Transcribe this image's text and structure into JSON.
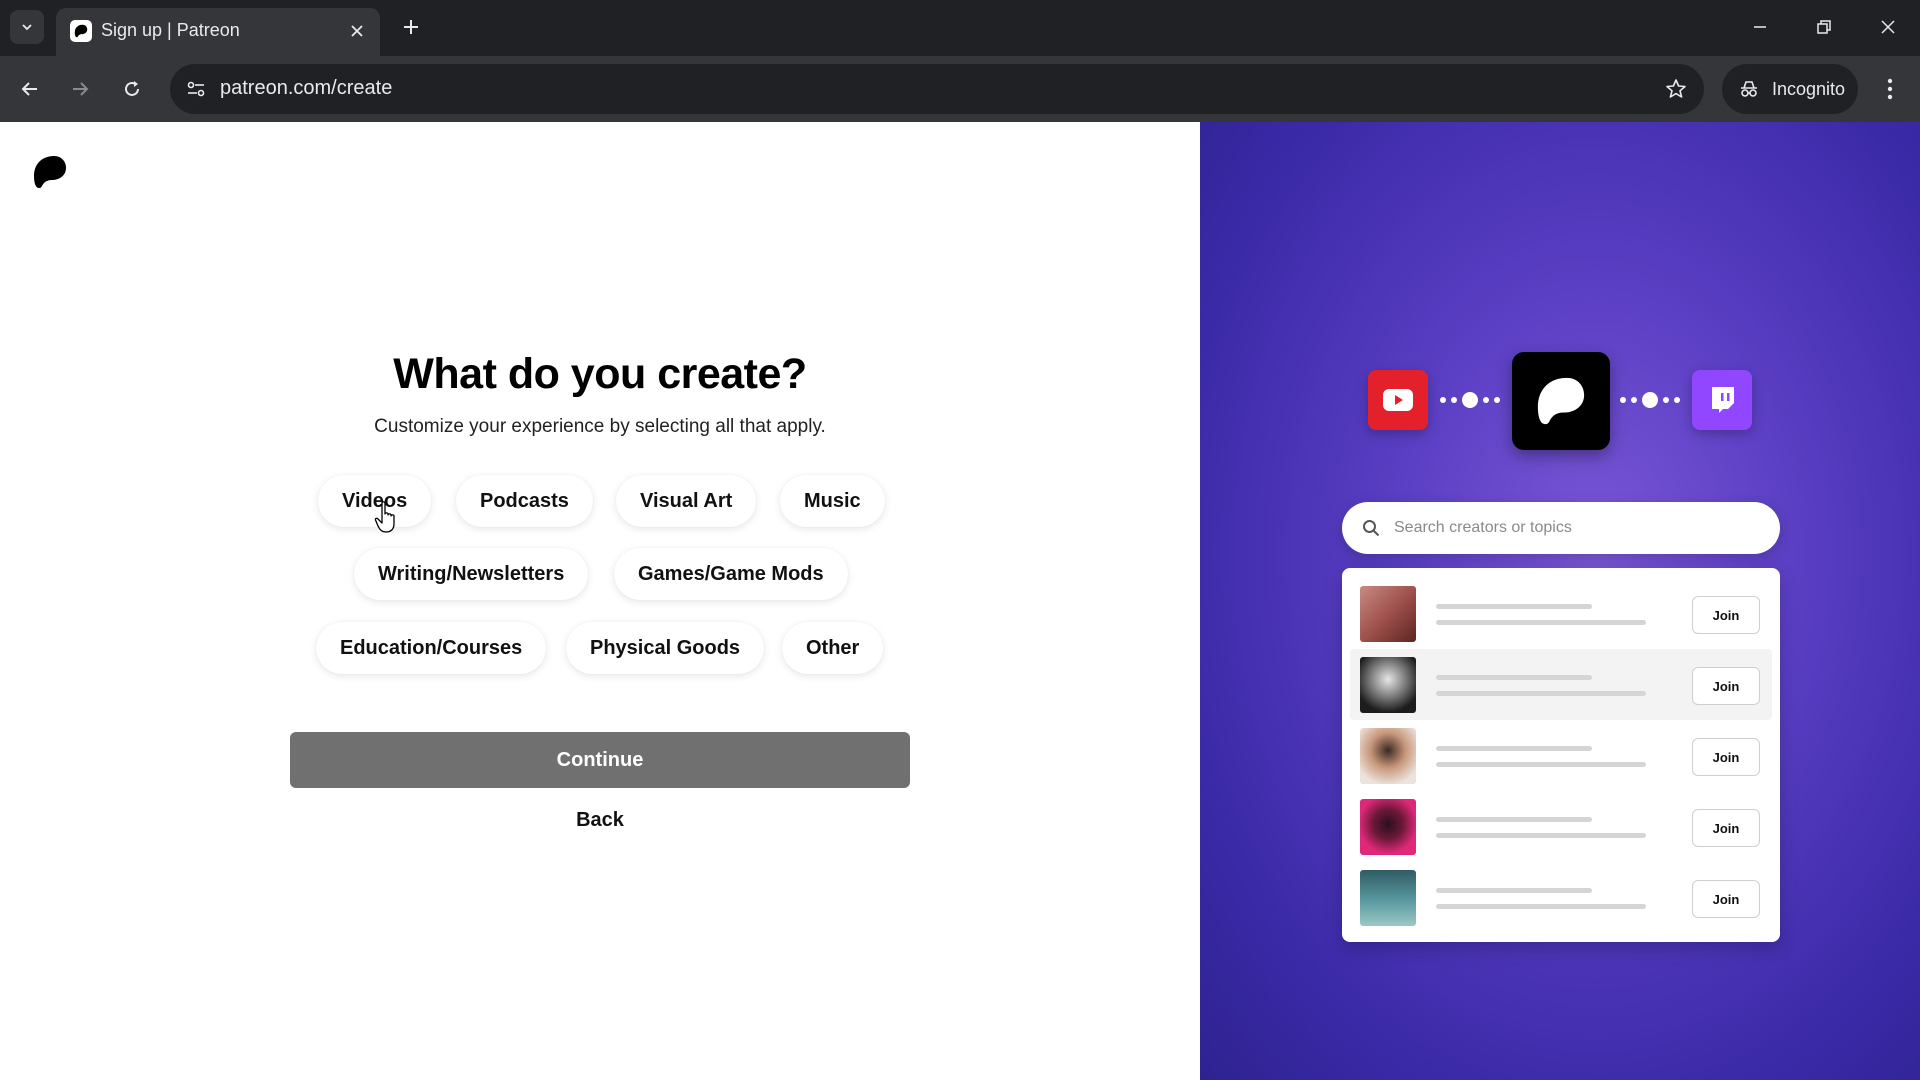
{
  "browser": {
    "tab_title": "Sign up | Patreon",
    "url": "patreon.com/create",
    "incognito_label": "Incognito"
  },
  "page": {
    "heading": "What do you create?",
    "subheading": "Customize your experience by selecting all that apply.",
    "categories": [
      "Videos",
      "Podcasts",
      "Visual Art",
      "Music",
      "Writing/Newsletters",
      "Games/Game Mods",
      "Education/Courses",
      "Physical Goods",
      "Other"
    ],
    "continue_label": "Continue",
    "back_label": "Back"
  },
  "promo": {
    "search_placeholder": "Search creators or topics",
    "join_label": "Join",
    "creators_count_visible": 5
  },
  "colors": {
    "chrome_dark": "#202124",
    "chrome_toolbar": "#35363a",
    "continue_disabled": "#707070",
    "promo_purple": "#5b3fc4",
    "youtube_red": "#e4202a",
    "twitch_purple": "#9146ff"
  }
}
